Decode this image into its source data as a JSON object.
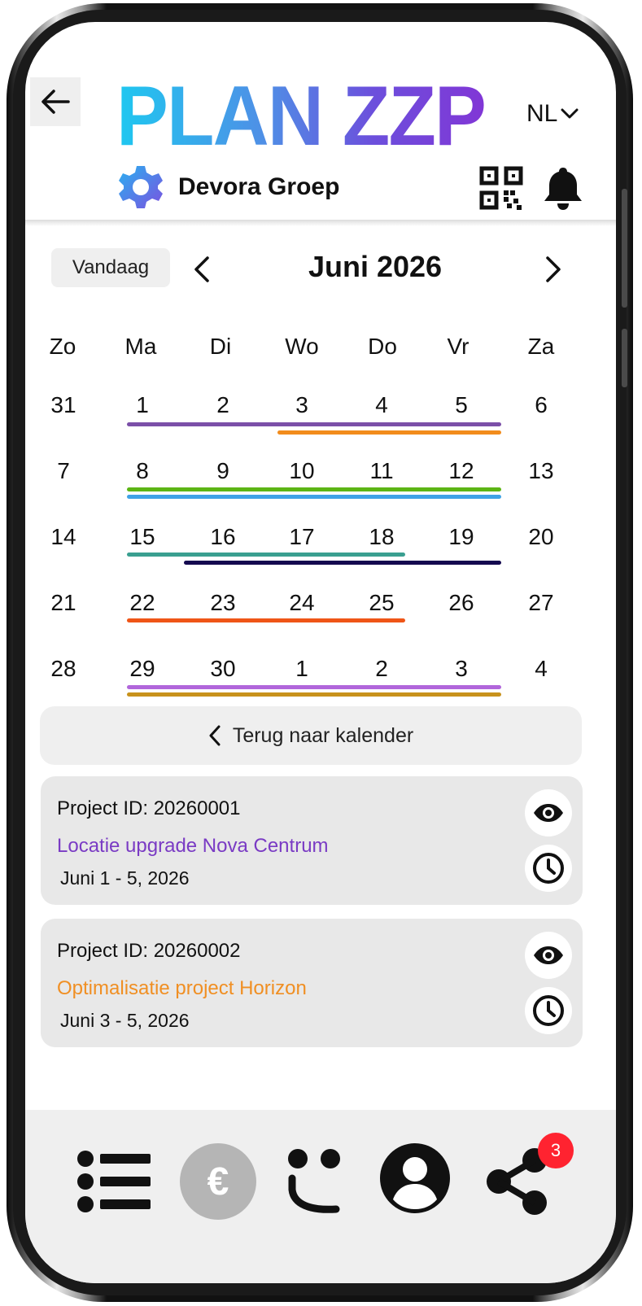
{
  "header": {
    "logo_text": "PLAN ZZP",
    "language": "NL",
    "organization": "Devora Groep"
  },
  "calendar": {
    "today_label": "Vandaag",
    "month_title": "Juni 2026",
    "weekdays": [
      "Zo",
      "Ma",
      "Di",
      "Wo",
      "Do",
      "Vr",
      "Za"
    ],
    "weeks": [
      [
        "31",
        "1",
        "2",
        "3",
        "4",
        "5",
        "6"
      ],
      [
        "7",
        "8",
        "9",
        "10",
        "11",
        "12",
        "13"
      ],
      [
        "14",
        "15",
        "16",
        "17",
        "18",
        "19",
        "20"
      ],
      [
        "21",
        "22",
        "23",
        "24",
        "25",
        "26",
        "27"
      ],
      [
        "28",
        "29",
        "30",
        "1",
        "2",
        "3",
        "4"
      ]
    ],
    "event_bar_colors": {
      "purple": "#7b4fa8",
      "orange": "#f28c1c",
      "green": "#5cb514",
      "blue": "#3fa2e6",
      "teal": "#3a9f90",
      "navy": "#14094f",
      "red_orange": "#ef5517",
      "lilac": "#b166db",
      "mustard": "#c8921c"
    }
  },
  "back_to_calendar_label": "Terug naar kalender",
  "projects": [
    {
      "id_label": "Project ID: 20260001",
      "name": "Locatie upgrade Nova Centrum",
      "name_color": "#7a3bc4",
      "dates": "Juni 1 - 5, 2026"
    },
    {
      "id_label": "Project ID: 20260002",
      "name": "Optimalisatie project Horizon",
      "name_color": "#f08f23",
      "dates": "Juni 3 - 5, 2026"
    }
  ],
  "bottom_nav": {
    "items": [
      "list-icon",
      "euro-icon",
      "face-icon",
      "account-icon",
      "share-icon"
    ],
    "euro_symbol": "€",
    "share_badge": "3"
  },
  "colors": {
    "logo_gradient_start": "#1ec8f0",
    "logo_gradient_end": "#8136d6",
    "badge": "#ff2330",
    "panel_gray": "#efefef"
  }
}
